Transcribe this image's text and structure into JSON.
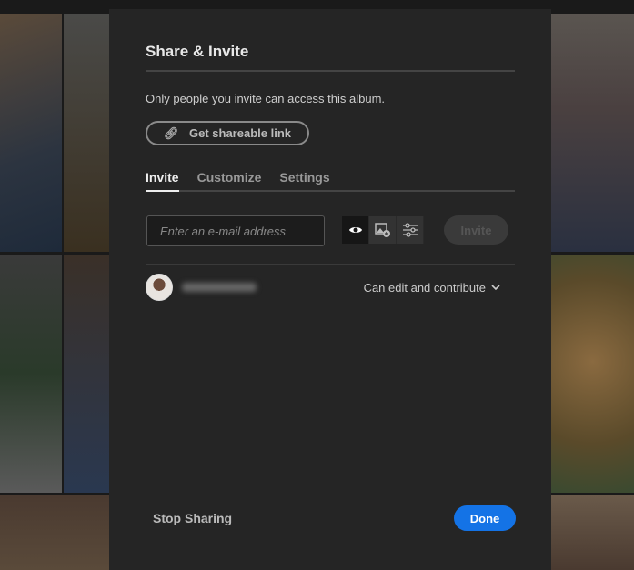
{
  "dialog": {
    "title": "Share & Invite",
    "description": "Only people you invite can access this album.",
    "shareable_link_label": "Get shareable link",
    "tabs": [
      {
        "label": "Invite",
        "active": true
      },
      {
        "label": "Customize",
        "active": false
      },
      {
        "label": "Settings",
        "active": false
      }
    ],
    "email_placeholder": "Enter an e-mail address",
    "role_icons": [
      "eye-icon",
      "add-photo-icon",
      "sliders-icon"
    ],
    "invite_label": "Invite",
    "member": {
      "permission": "Can edit and contribute"
    },
    "stop_sharing_label": "Stop Sharing",
    "done_label": "Done"
  },
  "colors": {
    "accent": "#1473e6",
    "panel": "#252525"
  }
}
